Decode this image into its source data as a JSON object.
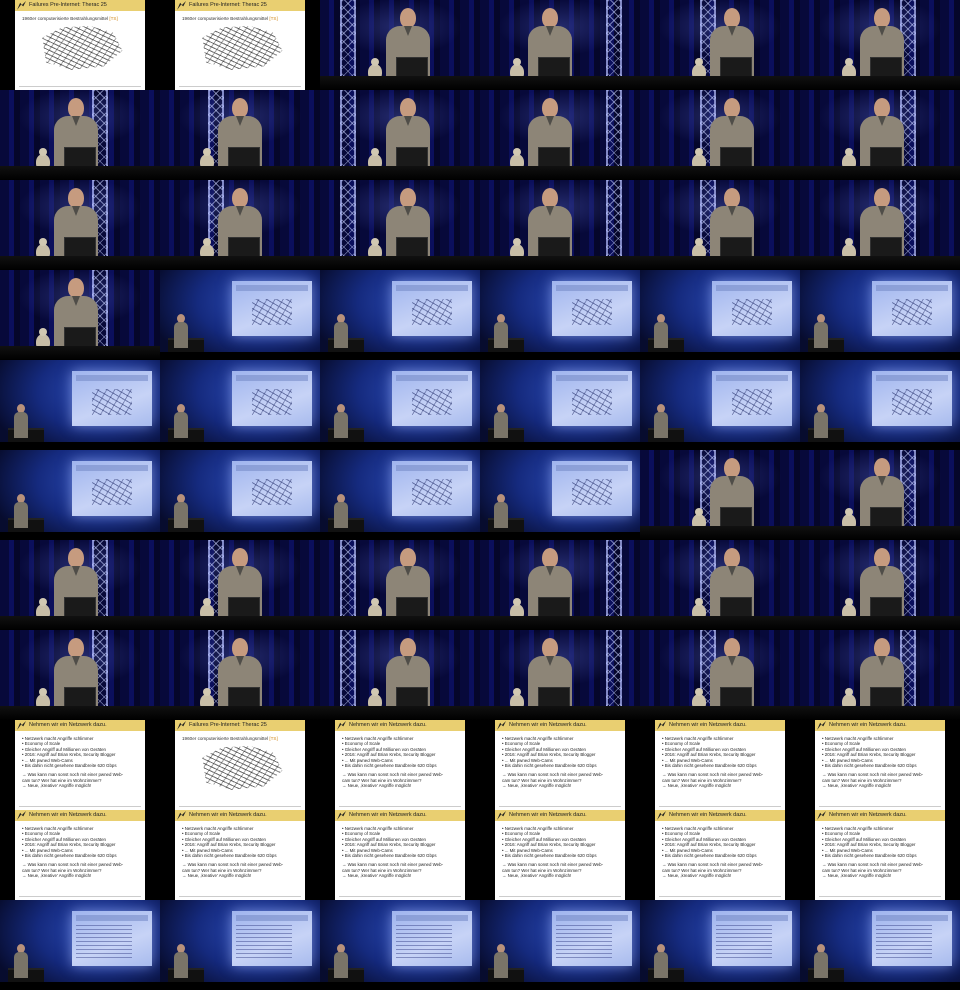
{
  "grid": {
    "columns": 6,
    "rows": 11
  },
  "slides": {
    "s1": {
      "title": "Failures Pre-Internet: Therac 25",
      "subtitle": "1960er computerisierte Bestrahlungsmittel",
      "ref": "[TS]"
    },
    "s2": {
      "title": "Nehmen wir ein Netzwerk dazu.",
      "bullets": [
        "• Netzwerk macht Angriffe schlimmer",
        "• Economy of Scale",
        "• Gleicher Angriff auf Millionen von Geräten",
        "• 2016: Angriff auf Brian Krebs, Security Blogger",
        "  • ... Mit pwned Web-Cams",
        "• Bis dahin nicht gesehene Bandbreite 620 Gbps"
      ],
      "questions": [
        "→ Was kann man sonst noch mit einer pwned Web-",
        "   cam tun? Wer hat eine im Wohnzimmer?",
        "→ Neue, ‚kreative' Angriffe möglich!"
      ]
    }
  },
  "tiles": [
    "slide1",
    "slide1",
    "stage",
    "stage",
    "stage",
    "stage",
    "stage",
    "stage",
    "stage",
    "stage",
    "stage",
    "stage",
    "stage",
    "stage",
    "stage",
    "stage",
    "stage",
    "stage",
    "stage",
    "wide",
    "wide",
    "wide",
    "wide",
    "wide",
    "wide",
    "wide",
    "wide",
    "wide",
    "wide",
    "wide",
    "wide",
    "wide",
    "wide",
    "wide",
    "stage",
    "stage",
    "stage",
    "stage",
    "stage",
    "stage",
    "stage",
    "stage",
    "stage",
    "stage",
    "stage",
    "stage",
    "stage",
    "stage",
    "slide2",
    "slide1",
    "slide2",
    "slide2",
    "slide2",
    "slide2",
    "slide2",
    "slide2",
    "slide2",
    "slide2",
    "slide2",
    "slide2",
    "wide",
    "wide",
    "wide",
    "wide",
    "wide",
    "wide"
  ]
}
